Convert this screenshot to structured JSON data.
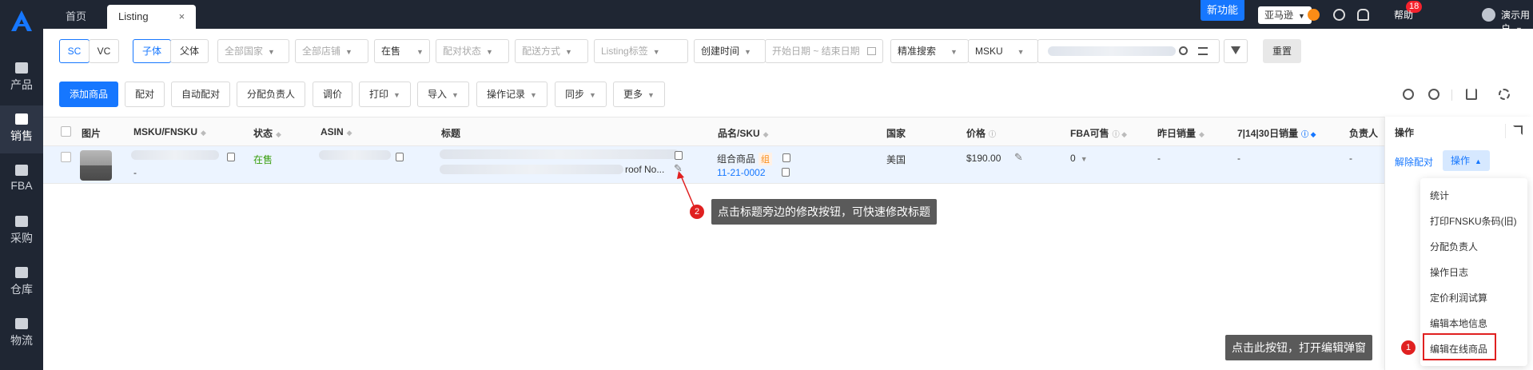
{
  "sidebar": {
    "items": [
      {
        "label": "产品",
        "icon": "product-icon"
      },
      {
        "label": "销售",
        "icon": "sell-icon"
      },
      {
        "label": "FBA",
        "icon": "fba-icon"
      },
      {
        "label": "采购",
        "icon": "cart-icon"
      },
      {
        "label": "仓库",
        "icon": "warehouse-icon"
      },
      {
        "label": "物流",
        "icon": "truck-icon"
      }
    ]
  },
  "tabs": [
    {
      "label": "首页"
    },
    {
      "label": "Listing"
    }
  ],
  "tab_close": "×",
  "topbar": {
    "new_feature": "新功能",
    "marketplace": "亚马逊",
    "notif_count": "18",
    "help": "帮助",
    "user": "演示用户"
  },
  "filters": {
    "sc": "SC",
    "vc": "VC",
    "child": "子体",
    "parent": "父体",
    "country": "全部国家",
    "shop": "全部店铺",
    "status": "在售",
    "match_status": "配对状态",
    "ship_method": "配送方式",
    "listing_tag": "Listing标签",
    "date_type": "创建时间",
    "date_range": "开始日期 ~ 结束日期",
    "search_mode": "精准搜索",
    "search_field": "MSKU",
    "reset": "重置"
  },
  "toolbar": {
    "add": "添加商品",
    "match": "配对",
    "auto_match": "自动配对",
    "assign": "分配负责人",
    "price": "调价",
    "print": "打印",
    "import": "导入",
    "oplog": "操作记录",
    "sync": "同步",
    "more": "更多"
  },
  "table": {
    "headers": {
      "image": "图片",
      "msku": "MSKU/FNSKU",
      "status": "状态",
      "asin": "ASIN",
      "title": "标题",
      "name_sku": "品名/SKU",
      "country": "国家",
      "price": "价格",
      "fba": "FBA可售",
      "yesterday": "昨日销量",
      "sales": "7|14|30日销量",
      "owner": "负责人",
      "ops": "操作"
    },
    "row": {
      "fnsku": "-",
      "status": "在售",
      "title_end": "roof No...",
      "product_name": "组合商品",
      "combo_tag": "组",
      "sku": "11-21-0002",
      "country": "美国",
      "price": "$190.00",
      "fba": "0",
      "yesterday": "-",
      "sales": "-",
      "owner": "-",
      "unmatch": "解除配对",
      "op": "操作"
    }
  },
  "menu": {
    "items": [
      "统计",
      "打印FNSKU条码(旧)",
      "分配负责人",
      "操作日志",
      "定价利润试算",
      "编辑本地信息",
      "编辑在线商品"
    ]
  },
  "annotations": {
    "tip1": "点击此按钮，打开编辑弹窗",
    "tip2": "点击标题旁边的修改按钮，可快速修改标题",
    "n1": "1",
    "n2": "2"
  },
  "colors": {
    "primary": "#1677ff",
    "success": "#389e0d",
    "annotation": "#e02020",
    "sidebar": "#1f2633"
  }
}
